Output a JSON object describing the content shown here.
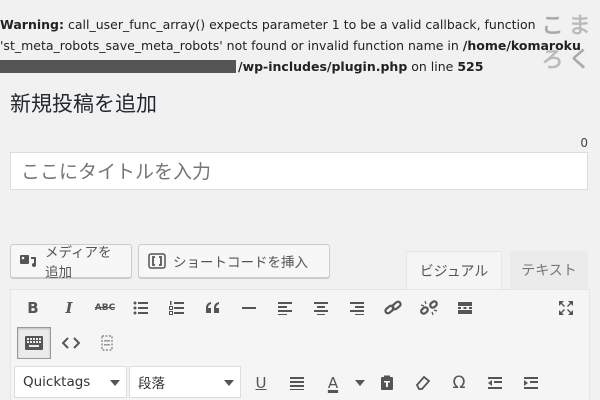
{
  "warning": {
    "label": "Warning",
    "line1_rest": "call_user_func_array() expects parameter 1 to be a valid callback, function",
    "line2_pre": "'st_meta_robots_save_meta_robots' not found or invalid function name in ",
    "line2_path": "/home/komaroku",
    "line3_path": "/wp-includes/plugin.php",
    "line3_mid": " on line ",
    "line3_line": "525"
  },
  "logo": {
    "chars": [
      "こ",
      "ま",
      "ろ",
      "く"
    ]
  },
  "page_title": "新規投稿を追加",
  "title_field": {
    "counter": "0",
    "placeholder": "ここにタイトルを入力"
  },
  "media_buttons": {
    "add_media": "メディアを追加",
    "insert_shortcode": "ショートコードを挿入"
  },
  "editor_tabs": {
    "visual": "ビジュアル",
    "text": "テキスト"
  },
  "toolbar": {
    "bold": "B",
    "italic": "I",
    "strikethrough": "ABC",
    "selects": {
      "quicktags": "Quicktags",
      "format": "段落"
    },
    "text_color": "A",
    "omega": "Ω"
  },
  "colors": {
    "background": "#f1f1f1",
    "toolbar": "#f5f5f5",
    "text": "#23282d"
  }
}
